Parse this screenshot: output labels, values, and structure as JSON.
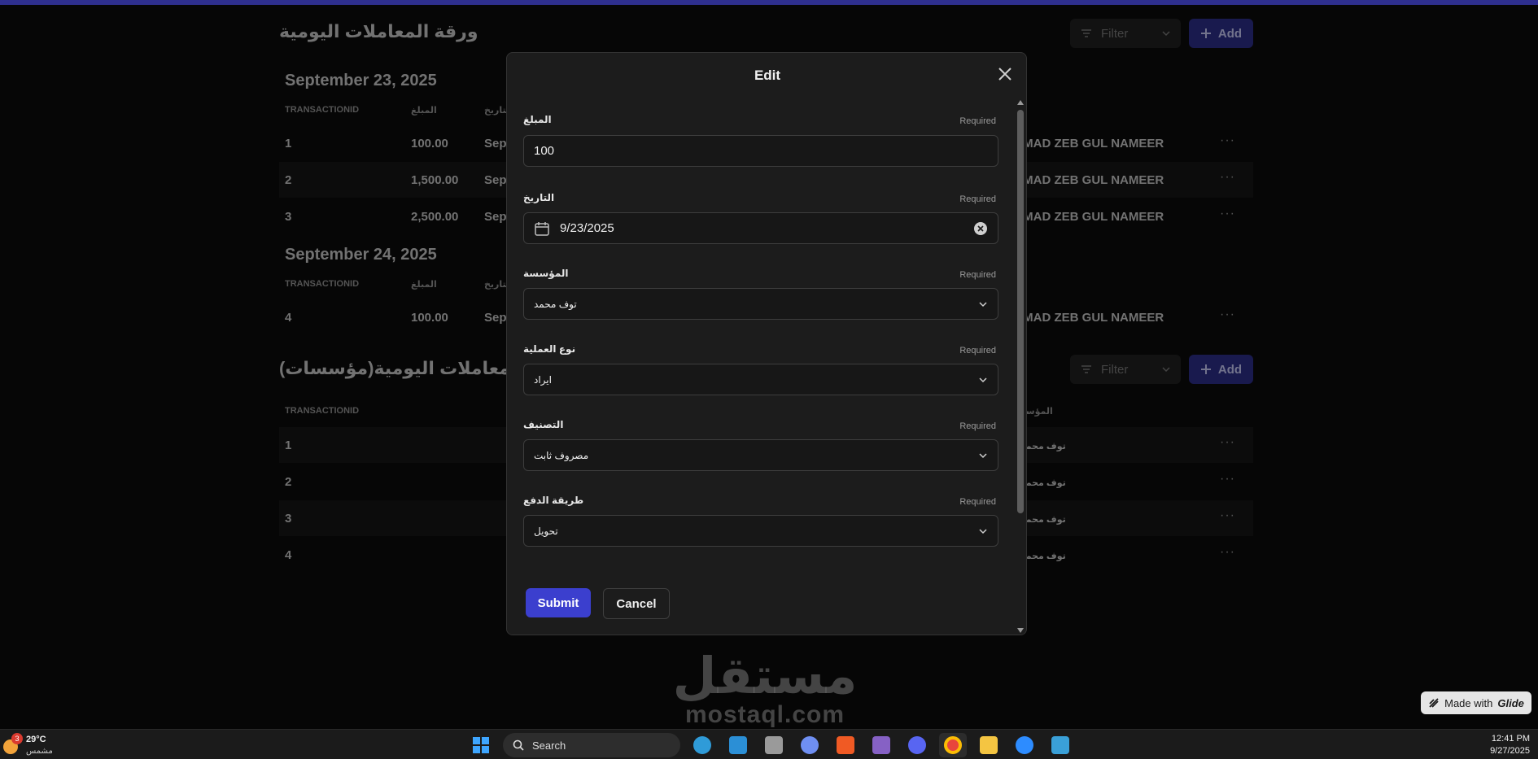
{
  "page": {
    "section1": {
      "title": "ورقة المعاملات اليومية",
      "filter_label": "Filter",
      "add_label": "Add",
      "groups": [
        {
          "date": "September 23, 2025",
          "columns": [
            "TRANSACTIONID",
            "المبلغ",
            "التاريخ"
          ],
          "rows": [
            {
              "id": "1",
              "amount": "100.00",
              "date": "Sept",
              "person": "IMAD ZEB GUL NAMEER"
            },
            {
              "id": "2",
              "amount": "1,500.00",
              "date": "Sept",
              "person": "IMAD ZEB GUL NAMEER"
            },
            {
              "id": "3",
              "amount": "2,500.00",
              "date": "Sept",
              "person": "IMAD ZEB GUL NAMEER"
            }
          ]
        },
        {
          "date": "September 24, 2025",
          "columns": [
            "TRANSACTIONID",
            "المبلغ",
            "التاريخ"
          ],
          "rows": [
            {
              "id": "4",
              "amount": "100.00",
              "date": "Sept",
              "person": "IMAD ZEB GUL NAMEER"
            }
          ]
        }
      ]
    },
    "section2": {
      "title": "ورقة المعاملات اليومية(مؤسسات)",
      "filter_label": "Filter",
      "add_label": "Add",
      "columns": [
        "TRANSACTIONID",
        "المؤسـ"
      ],
      "rows": [
        {
          "id": "1",
          "org": "توف محمـ"
        },
        {
          "id": "2",
          "org": "توف محمـ"
        },
        {
          "id": "3",
          "org": "توف محمـ"
        },
        {
          "id": "4",
          "org": "توف محمـ"
        }
      ]
    },
    "row_menu": "···"
  },
  "modal": {
    "title": "Edit",
    "required_label": "Required",
    "fields": [
      {
        "label": "المبلغ",
        "value": "100",
        "type": "number"
      },
      {
        "label": "التاريخ",
        "value": "9/23/2025",
        "type": "date"
      },
      {
        "label": "المؤسسة",
        "value": "توف محمد",
        "type": "select"
      },
      {
        "label": "نوع العملية",
        "value": "ايراد",
        "type": "select"
      },
      {
        "label": "التصنيف",
        "value": "مصروف ثابت",
        "type": "select"
      },
      {
        "label": "طريقة الدفع",
        "value": "تحويل",
        "type": "select"
      }
    ],
    "submit_label": "Submit",
    "cancel_label": "Cancel"
  },
  "watermark": {
    "arabic": "مستقل",
    "latin": "mostaql.com"
  },
  "glide_badge": {
    "prefix": "Made with",
    "brand": "Glide"
  },
  "taskbar": {
    "weather_temp": "29°C",
    "weather_condition": "مشمس",
    "weather_badge": "3",
    "search_label": "Search",
    "apps": [
      "windows-start",
      "search",
      "edge",
      "vscode",
      "unity",
      "copilot",
      "brave",
      "visual-studio",
      "discord",
      "chrome",
      "file-explorer",
      "zoom",
      "photos"
    ],
    "time": "12:41 PM",
    "date": "9/27/2025"
  },
  "colors": {
    "accent": "#3b3fce",
    "accent_dim": "#2e318f",
    "topbar": "#2e2f8e"
  }
}
